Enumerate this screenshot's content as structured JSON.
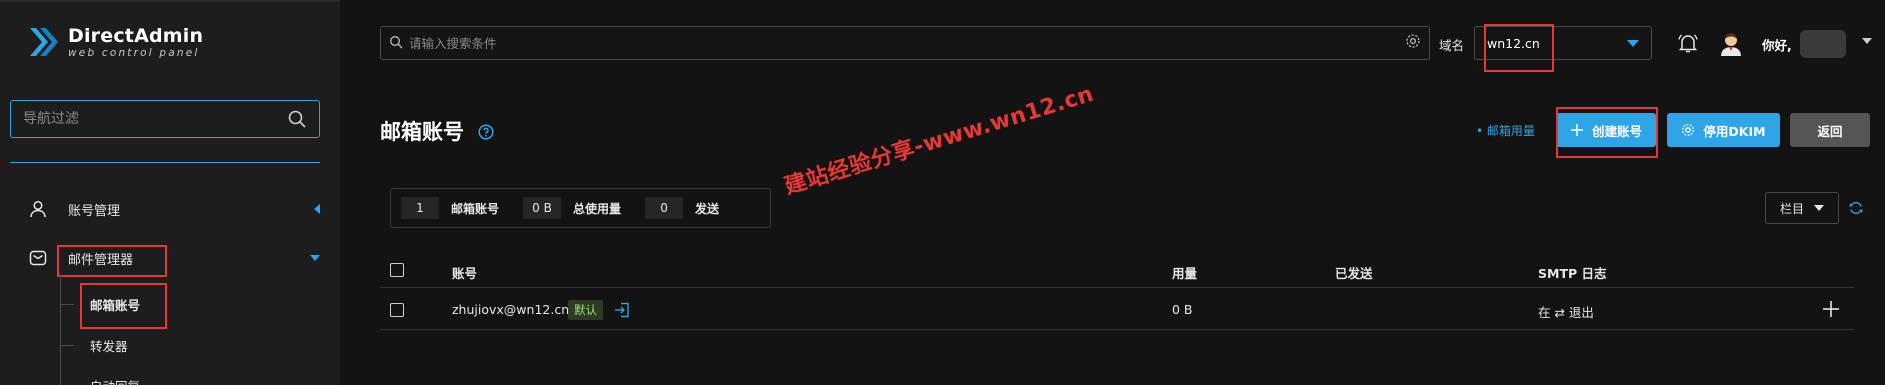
{
  "brand": {
    "title": "DirectAdmin",
    "subtitle": "web control panel",
    "accent_color": "#2fa4e7"
  },
  "sidebar": {
    "filter_placeholder": "导航过滤",
    "items": [
      {
        "label": "账号管理",
        "icon": "user-icon",
        "caret": "left"
      },
      {
        "label": "邮件管理器",
        "icon": "mail-icon",
        "caret": "down"
      }
    ],
    "subitems": [
      {
        "label": "邮箱账号"
      },
      {
        "label": "转发器"
      },
      {
        "label": "自动回复"
      }
    ]
  },
  "topbar": {
    "search_placeholder": "请输入搜索条件",
    "domain_label": "域名",
    "domain_value": "wn12.cn",
    "greeting": "你好,"
  },
  "header": {
    "title": "邮箱账号",
    "usage_link": "• 邮箱用量",
    "create_label": "创建账号",
    "dkim_label": "停用DKIM",
    "back_label": "返回"
  },
  "stats": [
    {
      "value": "1",
      "label": "邮箱账号"
    },
    {
      "value": "0 B",
      "label": "总使用量"
    },
    {
      "value": "0",
      "label": "发送"
    }
  ],
  "columns_button": "栏目",
  "table": {
    "headers": [
      "账号",
      "用量",
      "已发送",
      "SMTP 日志"
    ],
    "rows": [
      {
        "account": "zhujiovx@wn12.cn",
        "badge": "默认",
        "usage": "0 B",
        "sent": "",
        "smtp": "在 ⇄ 退出"
      }
    ]
  },
  "watermark": "建站经验分享-www.wn12.cn"
}
